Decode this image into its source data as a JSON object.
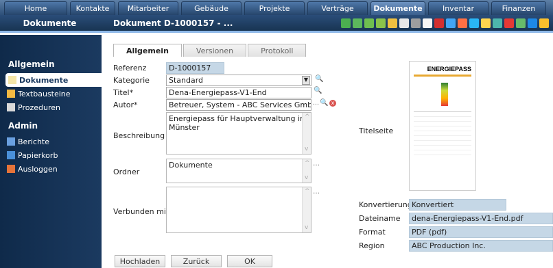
{
  "topnav": {
    "tabs": [
      "Home",
      "Kontakte",
      "Mitarbeiter",
      "Gebäude",
      "Projekte",
      "Verträge",
      "Dokumente",
      "Inventar",
      "Finanzen"
    ],
    "active": "Dokumente"
  },
  "titlebar": {
    "section": "Dokumente",
    "document": "Dokument D-1000157 - ..."
  },
  "sidebar": {
    "general_heading": "Allgemein",
    "general_items": [
      "Dokumente",
      "Textbausteine",
      "Prozeduren"
    ],
    "admin_heading": "Admin",
    "admin_items": [
      "Berichte",
      "Papierkorb",
      "Ausloggen"
    ]
  },
  "tabs": [
    "Allgemein",
    "Versionen",
    "Protokoll"
  ],
  "form": {
    "referenz_label": "Referenz",
    "referenz": "D-1000157",
    "kategorie_label": "Kategorie",
    "kategorie": "Standard",
    "titel_label": "Titel*",
    "titel": "Dena-Energiepass-V1-End",
    "autor_label": "Autor*",
    "autor": "Betreuer, System - ABC Services GmbH",
    "beschreibung_label": "Beschreibung",
    "beschreibung": "Energiepass für Hauptverwaltung in Münster",
    "ordner_label": "Ordner",
    "ordner": "Dokumente",
    "verbunden_label": "Verbunden mit",
    "verbunden": ""
  },
  "preview": {
    "titelseite_label": "Titelseite",
    "badge": "ENERGIEPASS"
  },
  "details": {
    "konvertierung_label": "Konvertierung",
    "konvertierung": "Konvertiert",
    "dateiname_label": "Dateiname",
    "dateiname": "dena-Energiepass-V1-End.pdf",
    "format_label": "Format",
    "format": "PDF (pdf)",
    "region_label": "Region",
    "region": "ABC Production Inc."
  },
  "buttons": {
    "hochladen": "Hochladen",
    "zurueck": "Zurück",
    "ok": "OK"
  },
  "colors": {
    "nav": "#2d4f78",
    "sidebar": "#1b3a60",
    "readonly_field": "#c5d7e6"
  }
}
